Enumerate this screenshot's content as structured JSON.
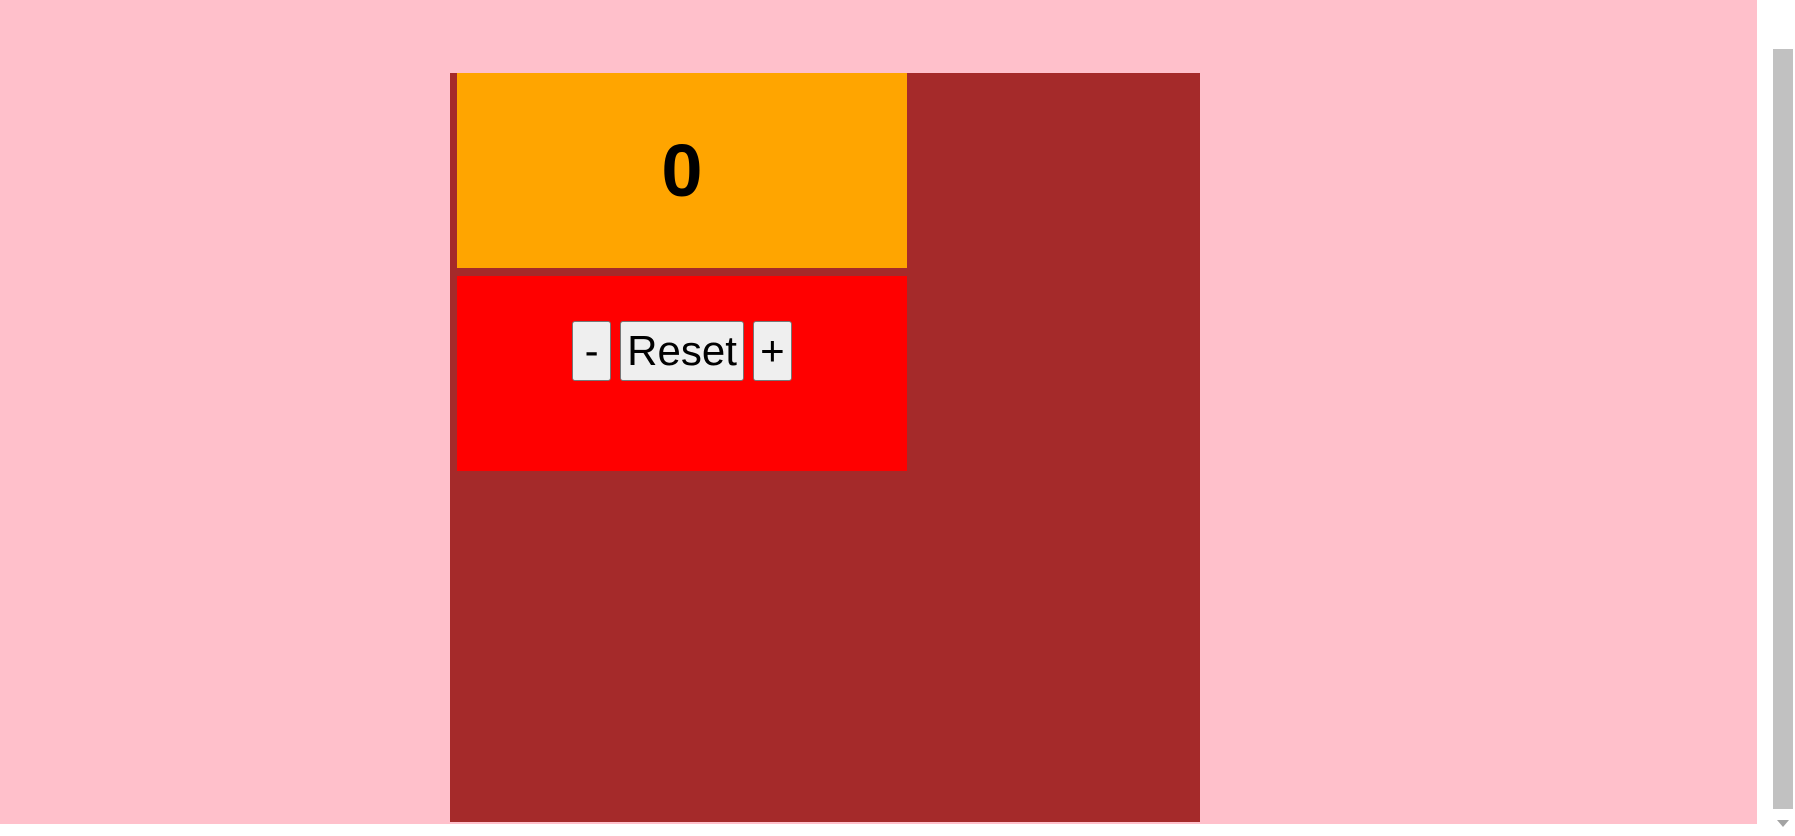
{
  "counter": {
    "value": "0"
  },
  "controls": {
    "decrement_label": "-",
    "reset_label": "Reset",
    "increment_label": "+"
  },
  "colors": {
    "page_background": "#ffc0cb",
    "container_background": "#a52a2a",
    "display_background": "#ffa500",
    "controls_background": "#ff0000"
  }
}
